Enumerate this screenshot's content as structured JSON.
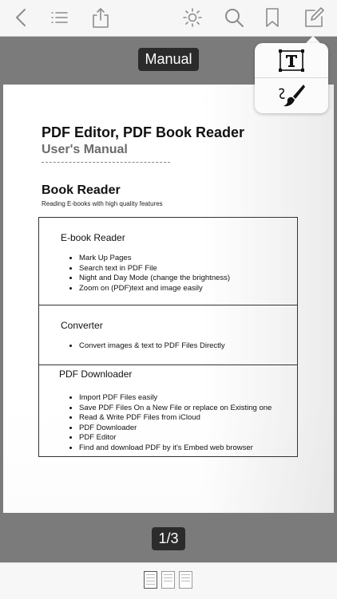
{
  "toolbar": {
    "icons": [
      "back-icon",
      "list-icon",
      "share-icon",
      "brightness-icon",
      "search-icon",
      "bookmark-icon",
      "edit-icon"
    ]
  },
  "document": {
    "title": "Manual",
    "heading": "PDF Editor, PDF Book Reader",
    "subheading": "User's Manual",
    "section_title": "Book Reader",
    "section_subtitle": "Reading E-books with high quality features",
    "boxes": [
      {
        "title": "E-book Reader",
        "items": [
          "Mark Up Pages",
          "Search text in PDF File",
          "Night and Day Mode (change the brightness)",
          "Zoom on (PDF)text and image easily"
        ]
      },
      {
        "title": "Converter",
        "items": [
          "Convert images & text to PDF Files Directly"
        ]
      },
      {
        "title": "PDF Downloader",
        "items": [
          "Import PDF Files easily",
          "Save PDF Files On a New File or replace on Existing one",
          "Read & Write PDF Files from iCloud",
          "PDF Downloader",
          "PDF Editor",
          "Find and download PDF by it's Embed web browser"
        ]
      }
    ]
  },
  "edit_menu": {
    "items": [
      "text-tool-icon",
      "brush-tool-icon"
    ]
  },
  "pager": {
    "label": "1/3",
    "thumbnail_count": 3
  }
}
